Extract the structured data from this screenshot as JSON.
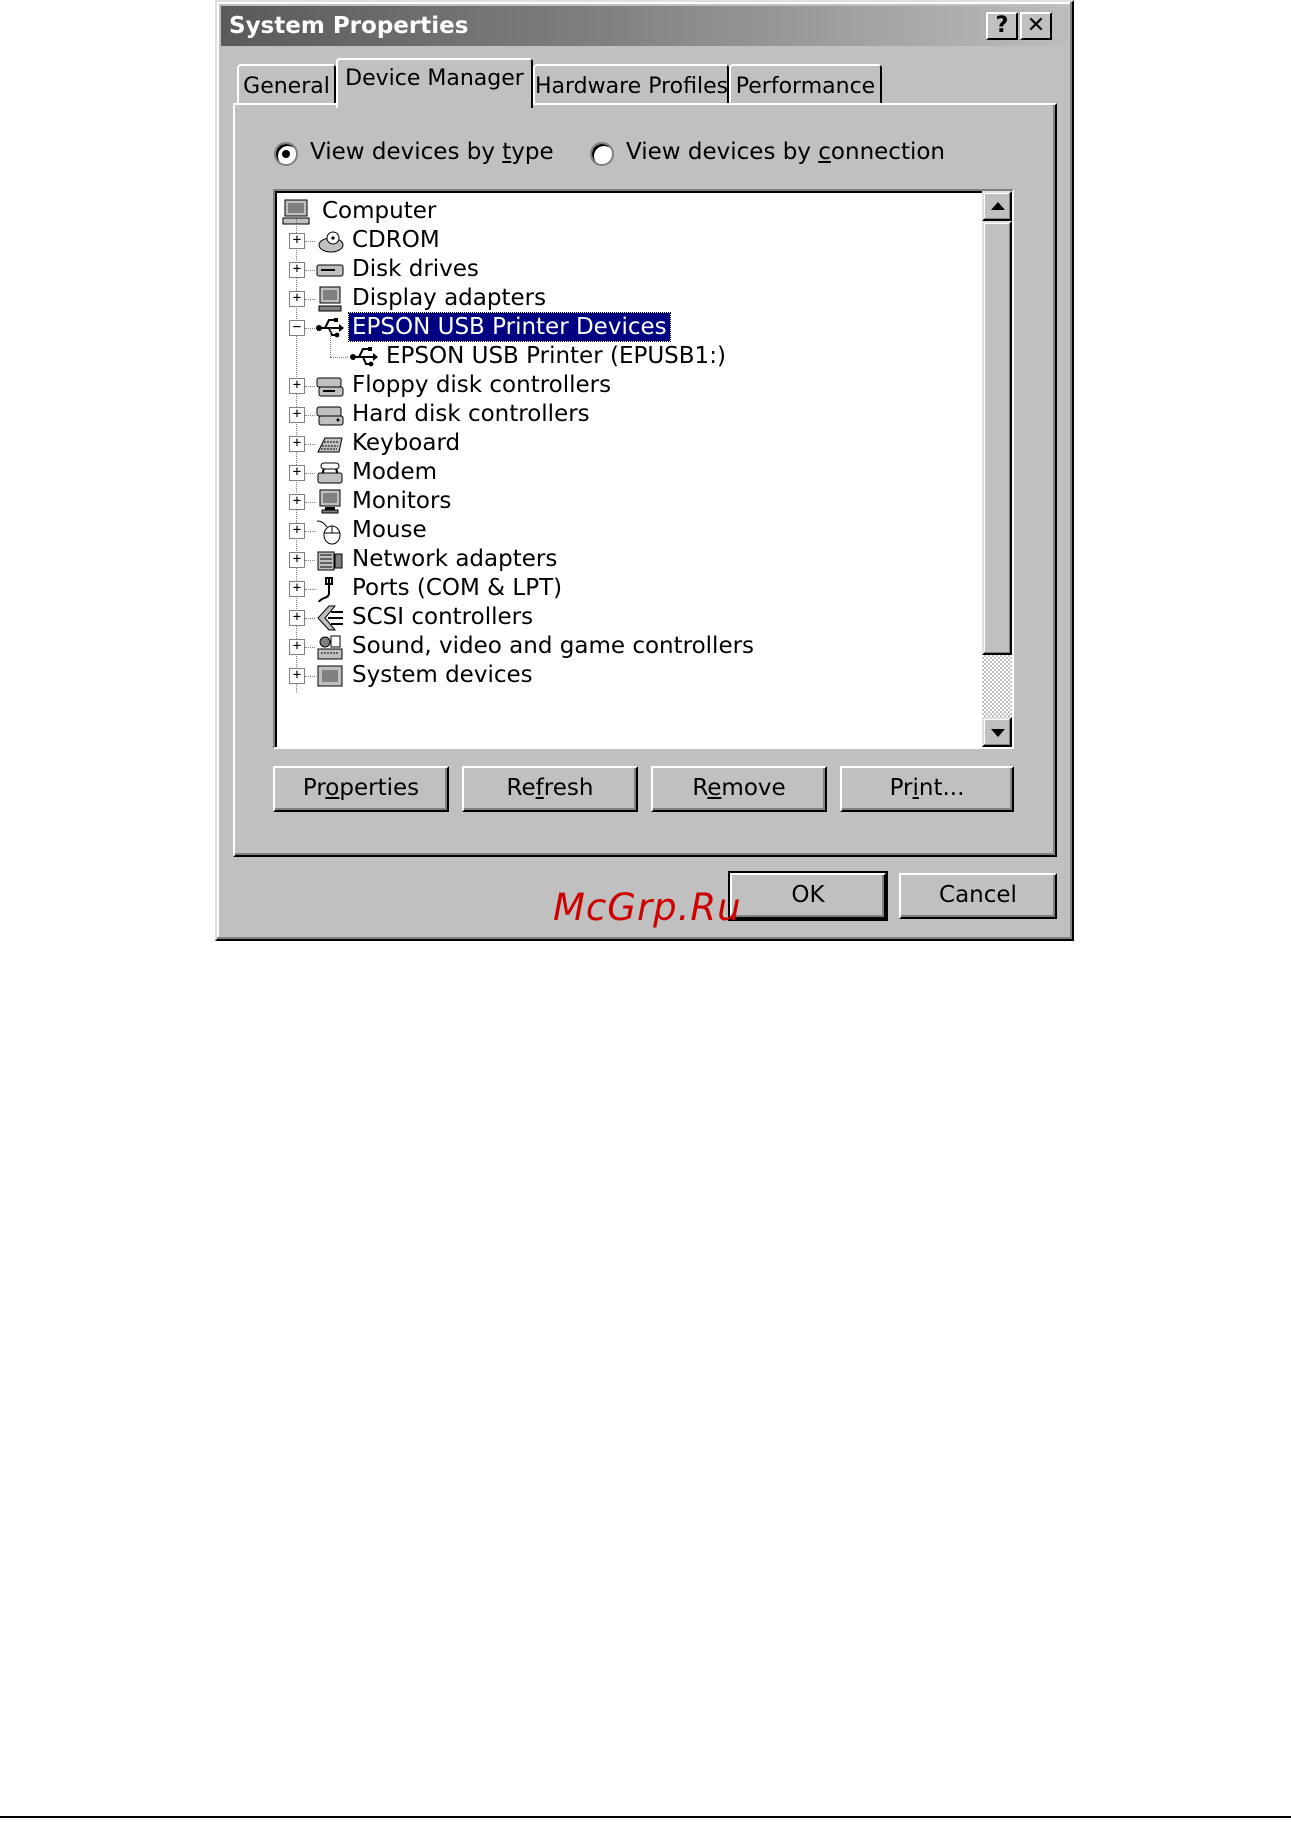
{
  "window": {
    "title": "System Properties",
    "help_label": "?",
    "close_label": "✕"
  },
  "tabs": [
    {
      "label": "General",
      "active": false
    },
    {
      "label": "Device Manager",
      "active": true
    },
    {
      "label": "Hardware Profiles",
      "active": false
    },
    {
      "label": "Performance",
      "active": false
    }
  ],
  "view_options": {
    "by_type": {
      "prefix": "View devices by ",
      "accel": "t",
      "suffix": "ype",
      "selected": true
    },
    "by_connection": {
      "prefix": "View devices by ",
      "accel": "c",
      "suffix": "onnection",
      "selected": false
    }
  },
  "tree": {
    "root": {
      "label": "Computer",
      "icon": "computer-icon"
    },
    "items": [
      {
        "label": "CDROM",
        "icon": "cdrom-icon",
        "expander": "+"
      },
      {
        "label": "Disk drives",
        "icon": "disk-drive-icon",
        "expander": "+"
      },
      {
        "label": "Display adapters",
        "icon": "display-adapter-icon",
        "expander": "+"
      },
      {
        "label": "EPSON USB Printer Devices",
        "icon": "usb-icon",
        "expander": "−",
        "selected": true
      },
      {
        "label": "EPSON USB Printer (EPUSB1:)",
        "icon": "usb-icon",
        "child": true
      },
      {
        "label": "Floppy disk controllers",
        "icon": "floppy-controller-icon",
        "expander": "+"
      },
      {
        "label": "Hard disk controllers",
        "icon": "hard-disk-controller-icon",
        "expander": "+"
      },
      {
        "label": "Keyboard",
        "icon": "keyboard-icon",
        "expander": "+"
      },
      {
        "label": "Modem",
        "icon": "modem-icon",
        "expander": "+"
      },
      {
        "label": "Monitors",
        "icon": "monitor-icon",
        "expander": "+"
      },
      {
        "label": "Mouse",
        "icon": "mouse-icon",
        "expander": "+"
      },
      {
        "label": "Network adapters",
        "icon": "network-adapter-icon",
        "expander": "+"
      },
      {
        "label": "Ports (COM & LPT)",
        "icon": "port-icon",
        "expander": "+"
      },
      {
        "label": "SCSI controllers",
        "icon": "scsi-icon",
        "expander": "+"
      },
      {
        "label": "Sound, video and game controllers",
        "icon": "sound-icon",
        "expander": "+"
      },
      {
        "label": "System devices",
        "icon": "system-device-icon",
        "expander": "+"
      }
    ]
  },
  "buttons": {
    "properties": {
      "pre": "Pr",
      "accel": "o",
      "post": "perties"
    },
    "refresh": {
      "pre": "Re",
      "accel": "f",
      "post": "resh"
    },
    "remove": {
      "pre": "R",
      "accel": "e",
      "post": "move"
    },
    "print": {
      "pre": "Pr",
      "accel": "i",
      "post": "nt..."
    },
    "ok": "OK",
    "cancel": "Cancel"
  },
  "watermark": "McGrp.Ru",
  "colors": {
    "face": "#c0c0c0",
    "selection": "#000080",
    "watermark": "#cc0000"
  }
}
